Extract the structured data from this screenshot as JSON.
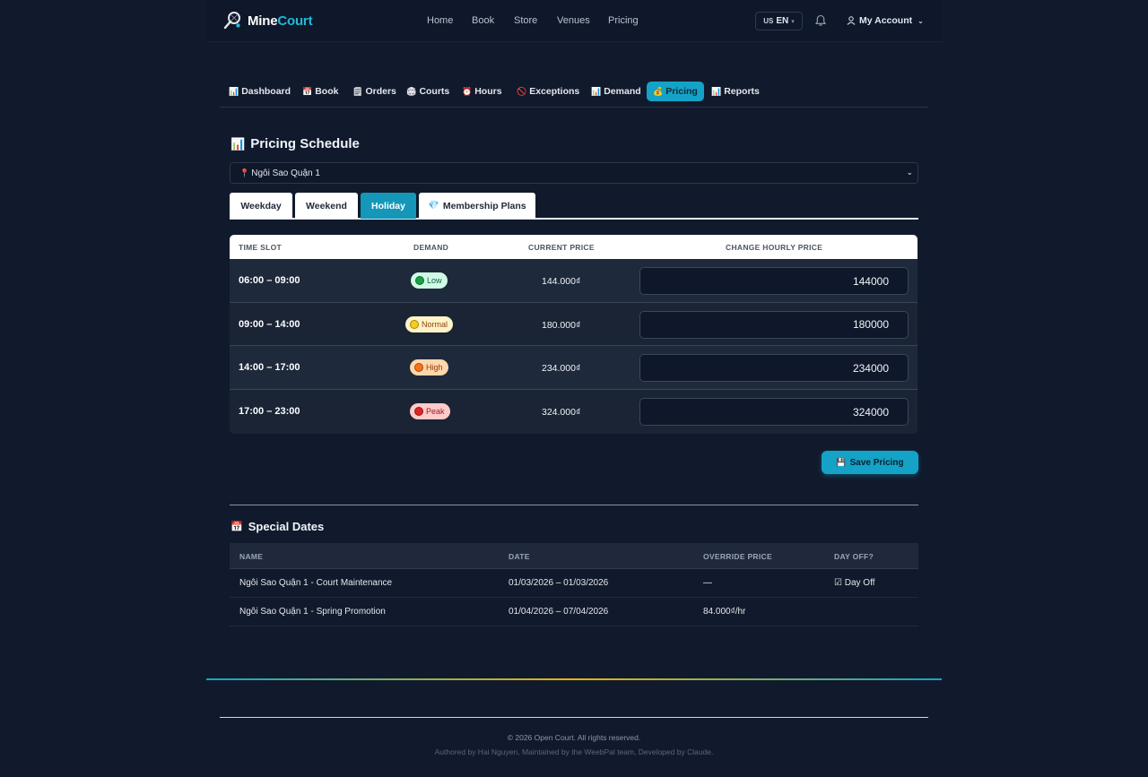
{
  "header": {
    "logo_mine": "Mine",
    "logo_court": "Court",
    "nav": [
      "Home",
      "Book",
      "Store",
      "Venues",
      "Pricing"
    ],
    "lang_flag": "US",
    "lang_code": "EN",
    "account_label": "My Account"
  },
  "subnav": [
    {
      "icon": "📊",
      "label": "Dashboard",
      "active": false
    },
    {
      "icon": "📅",
      "label": "Book",
      "active": false
    },
    {
      "icon": "🗒",
      "label": "Orders",
      "active": false
    },
    {
      "icon": "🏟",
      "label": "Courts",
      "active": false
    },
    {
      "icon": "⏰",
      "label": "Hours",
      "active": false
    },
    {
      "icon": "🚫",
      "label": "Exceptions",
      "active": false
    },
    {
      "icon": "📊",
      "label": "Demand",
      "active": false
    },
    {
      "icon": "💰",
      "label": "Pricing",
      "active": true
    },
    {
      "icon": "📊",
      "label": "Reports",
      "active": false
    }
  ],
  "pricing": {
    "title_icon": "📊",
    "title": "Pricing Schedule",
    "venue_pin": "📍",
    "venue": "Ngôi Sao Quận 1",
    "tabs": [
      {
        "label": "Weekday",
        "active": false
      },
      {
        "label": "Weekend",
        "active": false
      },
      {
        "label": "Holiday",
        "active": true
      },
      {
        "label": "Membership Plans",
        "icon": "💎",
        "active": false
      }
    ],
    "columns": {
      "slot": "TIME SLOT",
      "demand": "DEMAND",
      "current": "CURRENT PRICE",
      "change": "CHANGE HOURLY PRICE"
    },
    "rows": [
      {
        "slot": "06:00 – 09:00",
        "demand": "Low",
        "current": "144.000₫",
        "input": "144000"
      },
      {
        "slot": "09:00 – 14:00",
        "demand": "Normal",
        "current": "180.000₫",
        "input": "180000"
      },
      {
        "slot": "14:00 – 17:00",
        "demand": "High",
        "current": "234.000₫",
        "input": "234000"
      },
      {
        "slot": "17:00 – 23:00",
        "demand": "Peak",
        "current": "324.000₫",
        "input": "324000"
      }
    ],
    "save_icon": "💾",
    "save_label": "Save Pricing"
  },
  "special": {
    "title_icon": "📅",
    "title": "Special Dates",
    "columns": {
      "name": "NAME",
      "date": "DATE",
      "override": "OVERRIDE PRICE",
      "dayoff": "DAY OFF?"
    },
    "rows": [
      {
        "name": "Ngôi Sao Quận 1 - Court Maintenance",
        "date": "01/03/2026 – 01/03/2026",
        "override": "—",
        "dayoff": "☑ Day Off"
      },
      {
        "name": "Ngôi Sao Quận 1 - Spring Promotion",
        "date": "01/04/2026 – 07/04/2026",
        "override": "84.000₫/hr",
        "dayoff": ""
      }
    ]
  },
  "footer": {
    "copyright": "© 2026 Open Court. All rights reserved.",
    "credits": "Authored by Hai Nguyen, Maintained by the WeebPal team, Developed by Claude."
  },
  "colors": {
    "accent": "#14a3c7",
    "low_bg": "#d1fae5",
    "low_dot": "#16a34a",
    "low_text": "#065f46",
    "normal_bg": "#fef3c7",
    "normal_dot": "#facc15",
    "normal_text": "#92400e",
    "high_bg": "#fed7aa",
    "high_dot": "#f97316",
    "high_text": "#9a3412",
    "peak_bg": "#fecaca",
    "peak_dot": "#dc2626",
    "peak_text": "#991b1b"
  }
}
